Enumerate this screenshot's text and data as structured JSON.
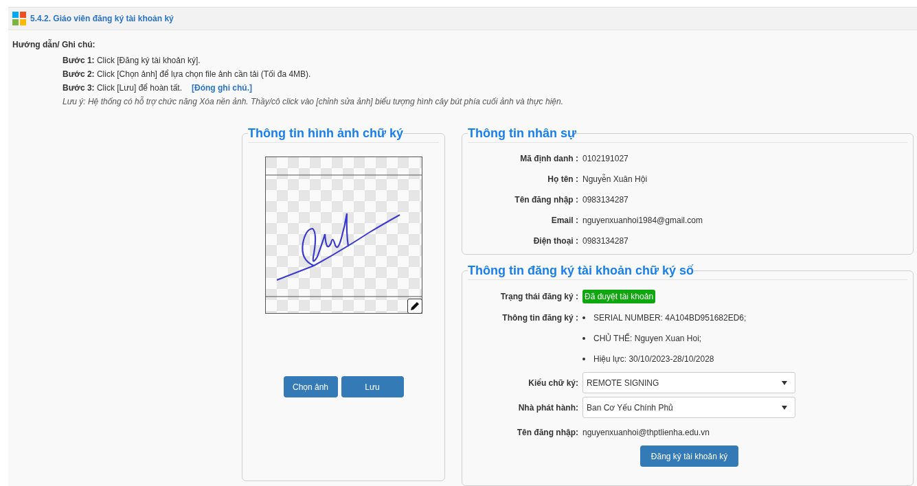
{
  "header": {
    "title": "5.4.2. Giáo viên đăng ký tài khoản ký"
  },
  "guide": {
    "heading": "Hướng dẫn/ Ghi chú:",
    "steps": [
      {
        "text": "**Bước 1:** Click [Đăng ký tài khoản ký]."
      },
      {
        "text": "**Bước 2:** Click [Chọn ảnh] để lựa chọn file ảnh cần tải (Tối đa 4MB)."
      },
      {
        "text": "**Bước 3:** Click [Lưu] để hoàn tất.",
        "link": "[Đóng ghi chú.]"
      }
    ],
    "note": "Lưu ý: Hệ thống có hỗ trợ chức năng Xóa nền ảnh. Thầy/cô click vào [chỉnh sửa ảnh] biểu tượng hình cây bút phía cuối ảnh và thực hiện."
  },
  "signature_panel": {
    "title": "Thông tin hình ảnh chữ ký",
    "buttons": [
      "Chọn ảnh",
      "Lưu"
    ]
  },
  "personnel": {
    "title": "Thông tin nhân sự",
    "fields": [
      {
        "label": "Mã định danh :",
        "value": "0102191027"
      },
      {
        "label": "Họ tên :",
        "value": "Nguyễn Xuân Hội"
      },
      {
        "label": "Tên đăng nhập :",
        "value": "0983134287"
      },
      {
        "label": "Email :",
        "value": "nguyenxuanhoi1984@gmail.com"
      },
      {
        "label": "Điện thoại :",
        "value": "0983134287"
      }
    ]
  },
  "registration": {
    "title": "Thông tin đăng ký tài khoản chữ ký số",
    "status": {
      "label": "Trạng thái đăng ký :",
      "value": "Đã duyệt tài khoản",
      "color": "#0ea80e"
    },
    "info": {
      "label": "Thông tin đăng ký :",
      "items": [
        "SERIAL NUMBER: 4A104BD951682ED6;",
        "CHỦ THỂ: Nguyen Xuan Hoi;",
        "Hiệu lực: 30/10/2023-28/10/2028"
      ]
    },
    "selects": [
      {
        "label": "Kiểu chữ ký:",
        "value": "REMOTE SIGNING"
      },
      {
        "label": "Nhà phát hành:",
        "value": "Ban Cơ Yếu Chính Phủ"
      }
    ],
    "login": {
      "label": "Tên đăng nhập:",
      "value": "nguyenxuanhoi@thptlienha.edu.vn"
    },
    "submit": "Đăng ký tài khoản ký"
  }
}
